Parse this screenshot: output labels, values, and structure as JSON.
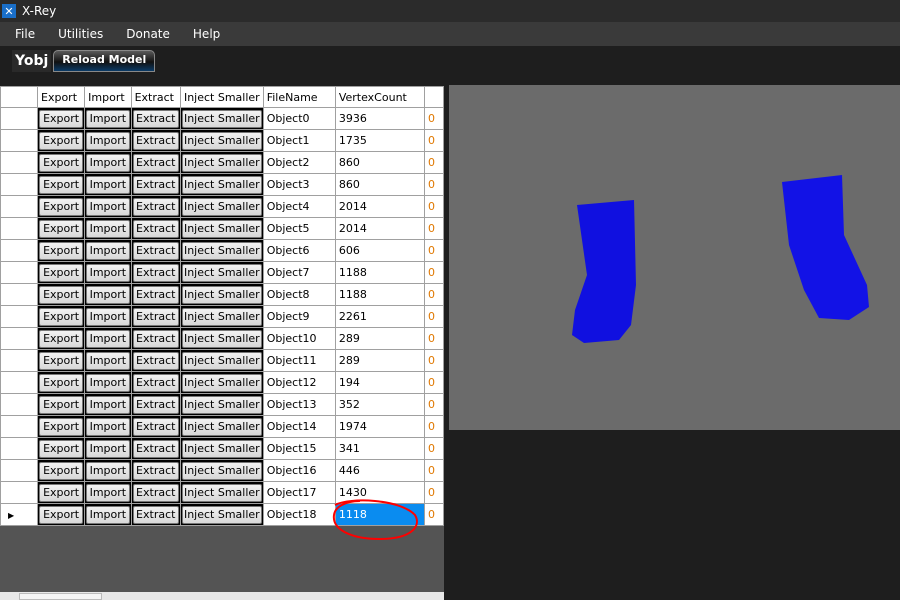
{
  "window": {
    "title": "X-Rey",
    "icon": "x-tools-icon"
  },
  "menu": [
    "File",
    "Utilities",
    "Donate",
    "Help"
  ],
  "toolbar": {
    "yobj_label": "Yobj",
    "reload_label": "Reload Model"
  },
  "grid": {
    "columns": [
      "Export",
      "Import",
      "Extract",
      "Inject Smaller",
      "FileName",
      "VertexCount"
    ],
    "button_labels": {
      "export": "Export",
      "import": "Import",
      "extract": "Extract",
      "inject": "Inject Smaller"
    },
    "rows": [
      {
        "file": "Object0",
        "verts": "3936"
      },
      {
        "file": "Object1",
        "verts": "1735"
      },
      {
        "file": "Object2",
        "verts": "860"
      },
      {
        "file": "Object3",
        "verts": "860"
      },
      {
        "file": "Object4",
        "verts": "2014"
      },
      {
        "file": "Object5",
        "verts": "2014"
      },
      {
        "file": "Object6",
        "verts": "606"
      },
      {
        "file": "Object7",
        "verts": "1188"
      },
      {
        "file": "Object8",
        "verts": "1188"
      },
      {
        "file": "Object9",
        "verts": "2261"
      },
      {
        "file": "Object10",
        "verts": "289"
      },
      {
        "file": "Object11",
        "verts": "289"
      },
      {
        "file": "Object12",
        "verts": "194"
      },
      {
        "file": "Object13",
        "verts": "352"
      },
      {
        "file": "Object14",
        "verts": "1974"
      },
      {
        "file": "Object15",
        "verts": "341"
      },
      {
        "file": "Object16",
        "verts": "446"
      },
      {
        "file": "Object17",
        "verts": "1430"
      },
      {
        "file": "Object18",
        "verts": "1118"
      }
    ],
    "partial_col_value": "0",
    "selected_row": 18,
    "selected_color": "#0a8cf0"
  },
  "annotation": {
    "color": "#ff0000"
  },
  "model": {
    "color": "#1010e0"
  }
}
